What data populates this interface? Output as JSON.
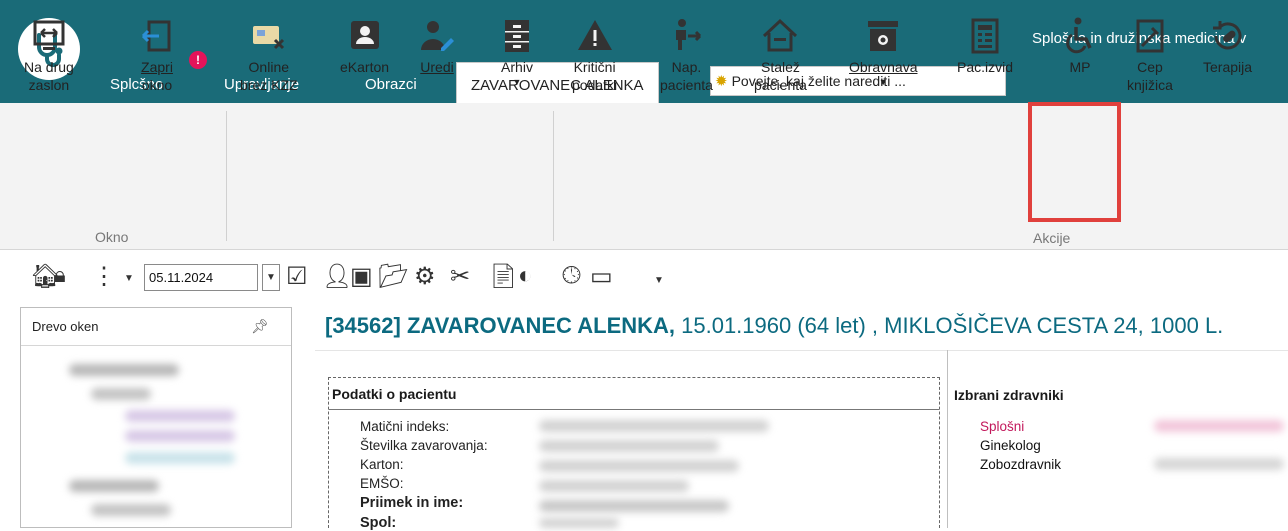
{
  "window": {
    "title": "Splošna in družinska medicina v"
  },
  "tabs": [
    {
      "label": "Splcšno"
    },
    {
      "label": "Upravljanje"
    },
    {
      "label": "Obrazci"
    },
    {
      "label": "ZAVAROVANEC ALENKA"
    }
  ],
  "notification_badge": "!",
  "tellme": {
    "placeholder": "Povejte, kaj želite narediti ..."
  },
  "ribbon": {
    "groups": [
      {
        "label": "Okno"
      },
      {
        "label": "Akcije"
      }
    ],
    "buttons": [
      {
        "line1": "Na drug",
        "line2": "zaslon"
      },
      {
        "line1": "Zapri",
        "line2": "okno"
      },
      {
        "line1": "Online",
        "line2": "brez KZZ"
      },
      {
        "line1": "eKarton",
        "line2": ""
      },
      {
        "line1": "Uredi",
        "line2": ""
      },
      {
        "line1": "Arhiv",
        "line2": ""
      },
      {
        "line1": "Kritični",
        "line2": "podatki"
      },
      {
        "line1": "Nap.",
        "line2": "pacienta"
      },
      {
        "line1": "Stalež",
        "line2": "pacienta"
      },
      {
        "line1": "Obravnava",
        "line2": ""
      },
      {
        "line1": "Pac.izvid",
        "line2": ""
      },
      {
        "line1": "MP",
        "line2": ""
      },
      {
        "line1": "Cep",
        "line2": "knjižica"
      },
      {
        "line1": "Terapija",
        "line2": ""
      }
    ]
  },
  "quickbar": {
    "date": "05.11.2024"
  },
  "left_panel": {
    "title": "Drevo oken"
  },
  "patient": {
    "header_bold": "[34562] ZAVAROVANEC ALENKA,",
    "header_rest": " 15.01.1960 (64 let) , MIKLOŠIČEVA CESTA 24, 1000  L."
  },
  "patient_data": {
    "title": "Podatki o pacientu",
    "fields": [
      "Matični indeks:",
      "Številka zavarovanja:",
      "Karton:",
      "EMŠO:",
      "Priimek in ime:",
      "Spol:"
    ]
  },
  "doctors": {
    "title": "Izbrani zdravniki",
    "items": [
      "Splošni",
      "Ginekolog",
      "Zobozdravnik"
    ]
  },
  "colors": {
    "brand": "#1a6b78",
    "accent_red": "#e0403c",
    "badge": "#e4135a",
    "header_text": "#0c6a80",
    "doctor_highlight": "#c2185b"
  }
}
